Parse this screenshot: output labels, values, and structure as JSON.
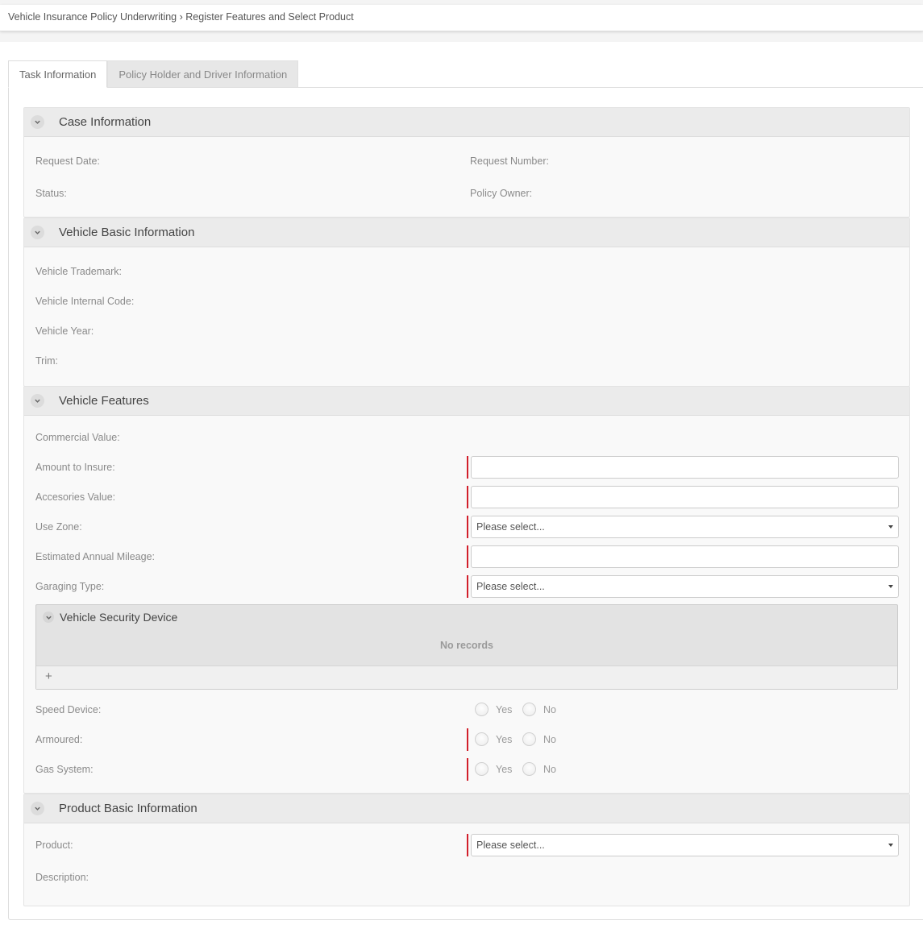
{
  "breadcrumb": {
    "parent": "Vehicle Insurance Policy Underwriting",
    "separator": "›",
    "current": "Register Features and Select Product"
  },
  "tabs": [
    {
      "label": "Task Information",
      "active": true
    },
    {
      "label": "Policy Holder and Driver Information",
      "active": false
    }
  ],
  "case_information": {
    "title": "Case Information",
    "fields": {
      "request_date": "Request Date:",
      "request_number": "Request Number:",
      "status": "Status:",
      "policy_owner": "Policy Owner:"
    }
  },
  "vehicle_basic": {
    "title": "Vehicle Basic Information",
    "fields": {
      "trademark": "Vehicle Trademark:",
      "internal_code": "Vehicle Internal Code:",
      "year": "Vehicle Year:",
      "trim": "Trim:"
    }
  },
  "vehicle_features": {
    "title": "Vehicle Features",
    "fields": {
      "commercial_value": "Commercial Value:",
      "amount_to_insure": {
        "label": "Amount to Insure:",
        "value": ""
      },
      "accessories_value": {
        "label": "Accesories Value:",
        "value": ""
      },
      "use_zone": {
        "label": "Use Zone:",
        "selected": "Please select..."
      },
      "annual_mileage": {
        "label": "Estimated Annual Mileage:",
        "value": ""
      },
      "garaging_type": {
        "label": "Garaging Type:",
        "selected": "Please select..."
      }
    },
    "security_device": {
      "title": "Vehicle Security Device",
      "empty_text": "No records",
      "add_icon": "+"
    },
    "radios": {
      "yes_label": "Yes",
      "no_label": "No",
      "speed_device": "Speed Device:",
      "armoured": "Armoured:",
      "gas_system": "Gas System:"
    }
  },
  "product_basic": {
    "title": "Product Basic Information",
    "fields": {
      "product": {
        "label": "Product:",
        "selected": "Please select..."
      },
      "description": "Description:"
    }
  },
  "colors": {
    "required_marker": "#d21f2b",
    "section_header_bg": "#ebebeb"
  }
}
